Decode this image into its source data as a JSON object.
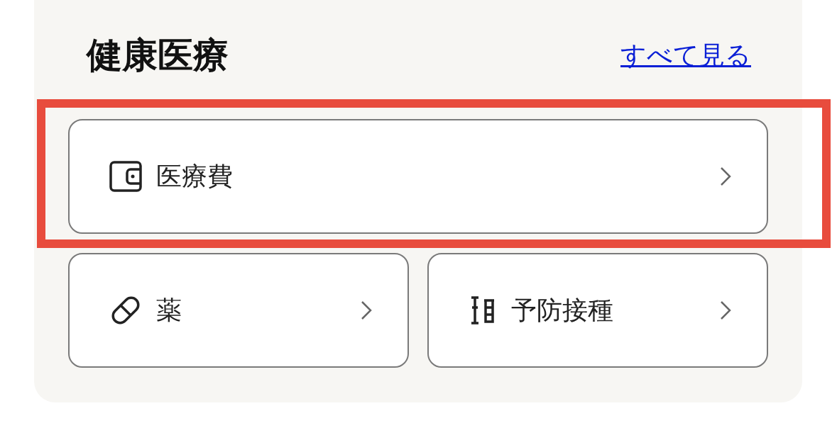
{
  "section": {
    "title": "健康医療",
    "see_all": "すべて見る"
  },
  "items": [
    {
      "label": "医療費",
      "kind": "wide",
      "highlighted": true
    },
    {
      "label": "薬",
      "kind": "half",
      "highlighted": false
    },
    {
      "label": "予防接種",
      "kind": "half",
      "highlighted": false
    }
  ]
}
